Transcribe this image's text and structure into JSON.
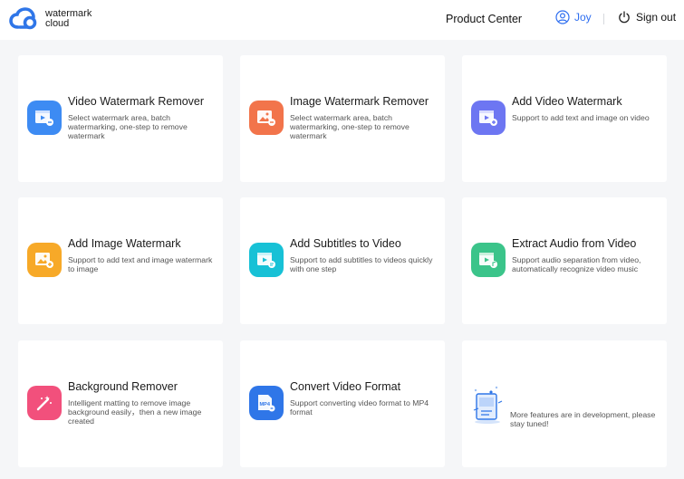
{
  "header": {
    "logo_line1": "watermark",
    "logo_line2": "cloud",
    "product_center": "Product Center",
    "username": "Joy",
    "signout": "Sign out"
  },
  "colors": {
    "accent": "#2f6ff0",
    "blue": "#3d8bf3",
    "orange": "#f2744b",
    "purple": "#6d76f2",
    "yellow": "#f7a928",
    "cyan": "#17c1d6",
    "green": "#3bc48a",
    "pink": "#f2507c",
    "navy": "#2f76e8"
  },
  "cards": [
    {
      "title": "Video Watermark Remover",
      "desc": "Select watermark area, batch watermarking, one-step to remove watermark",
      "icon": "video-remove-icon"
    },
    {
      "title": "Image Watermark Remover",
      "desc": "Select watermark area, batch watermarking, one-step to remove watermark",
      "icon": "image-remove-icon"
    },
    {
      "title": "Add Video Watermark",
      "desc": "Support to add text and image on video",
      "icon": "video-add-icon"
    },
    {
      "title": "Add Image Watermark",
      "desc": "Support to add text and image watermark to image",
      "icon": "image-add-icon"
    },
    {
      "title": "Add Subtitles to Video",
      "desc": "Support to add subtitles to videos quickly with one step",
      "icon": "subtitle-icon"
    },
    {
      "title": "Extract Audio from Video",
      "desc": "Support audio separation from video, automatically recognize video music",
      "icon": "audio-extract-icon"
    },
    {
      "title": "Background Remover",
      "desc": "Intelligent matting to remove image background easily，then a new image created",
      "icon": "magic-wand-icon"
    },
    {
      "title": "Convert Video Format",
      "desc": "Support converting video format to MP4 format",
      "icon": "mp4-file-icon",
      "badge": "MP4"
    },
    {
      "title": "",
      "desc": "More features are in development, please stay tuned!",
      "icon": "development-illustration-icon"
    }
  ]
}
